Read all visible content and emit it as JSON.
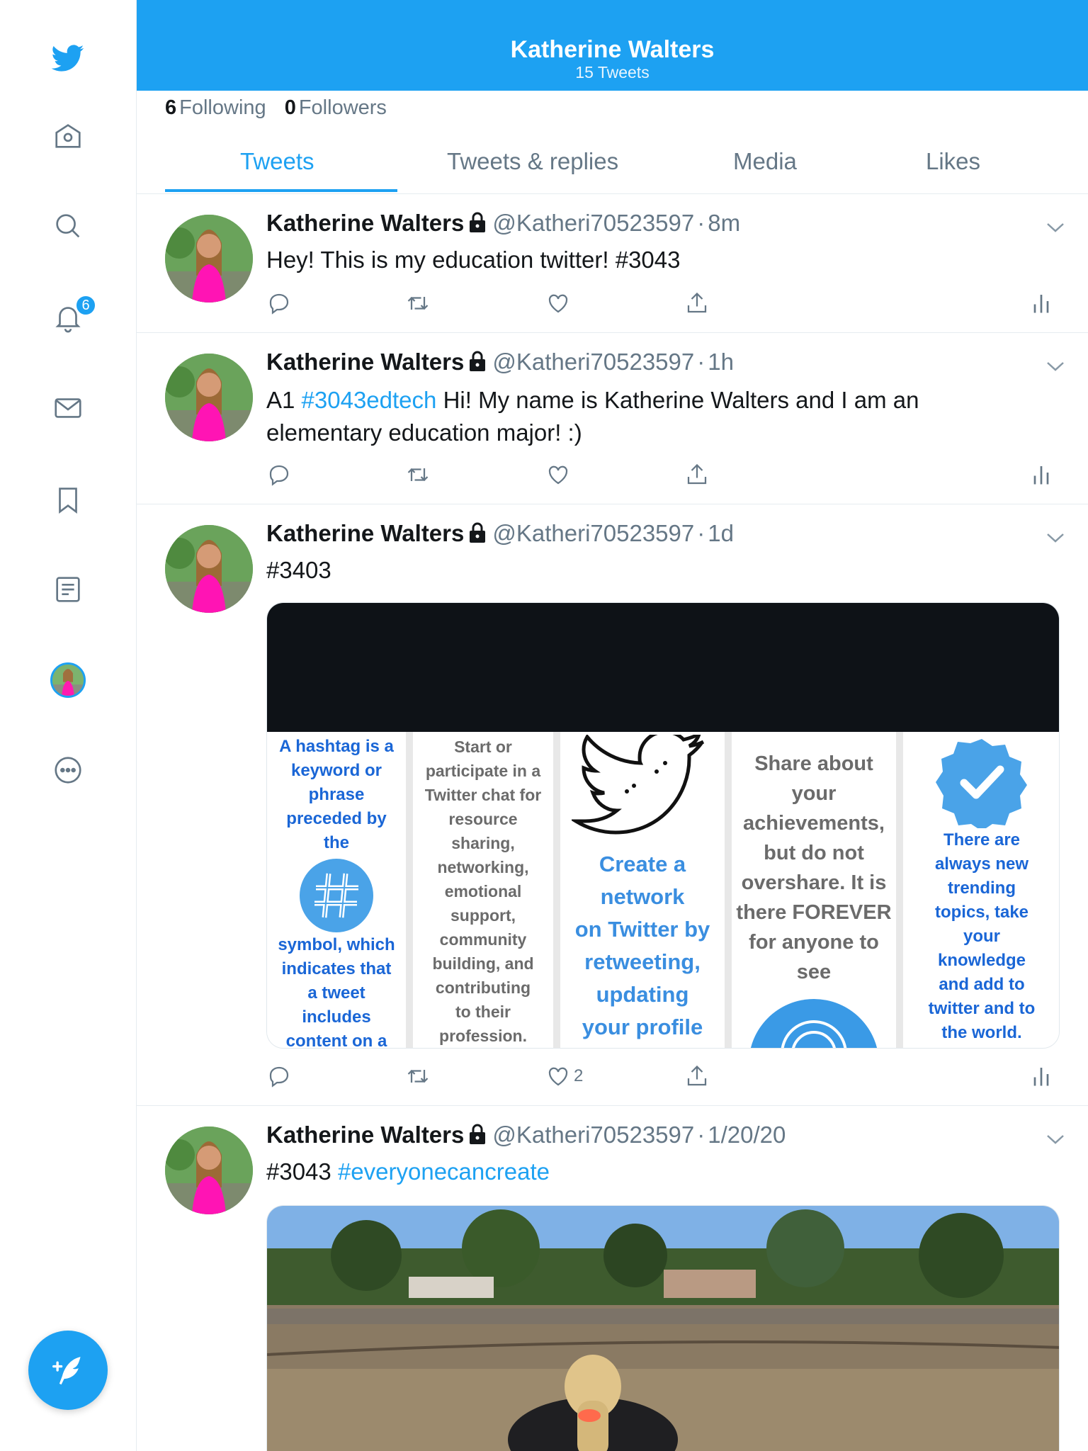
{
  "header": {
    "name": "Katherine Walters",
    "tweet_count": "15 Tweets"
  },
  "stats": {
    "following_count": "6",
    "following_label": "Following",
    "followers_count": "0",
    "followers_label": "Followers"
  },
  "tabs": [
    {
      "label": "Tweets",
      "active": true
    },
    {
      "label": "Tweets & replies",
      "active": false
    },
    {
      "label": "Media",
      "active": false
    },
    {
      "label": "Likes",
      "active": false
    }
  ],
  "sidebar": {
    "items": [
      "twitter-logo",
      "home-icon",
      "search-icon",
      "bell-icon",
      "mail-icon",
      "bookmark-icon",
      "list-icon",
      "profile-avatar",
      "more-icon"
    ],
    "notification_badge": "6"
  },
  "tweets": [
    {
      "name": "Katherine Walters",
      "handle": "@Katheri70523597",
      "sep": "·",
      "time": "8m",
      "text": "Hey! This is my education twitter! #3043"
    },
    {
      "name": "Katherine Walters",
      "handle": "@Katheri70523597",
      "sep": "·",
      "time": "1h",
      "text_prefix": "A1 ",
      "hashtag": "#3043edtech",
      "text_suffix": " Hi! My name is Katherine Walters and I am an elementary education major! :)"
    },
    {
      "name": "Katherine Walters",
      "handle": "@Katheri70523597",
      "sep": "·",
      "time": "1d",
      "text": "#3403",
      "like_count": "2",
      "infographic": {
        "col1_top": [
          "A hashtag is a",
          "keyword or",
          "phrase",
          "preceded by",
          "the"
        ],
        "col1_bottom": [
          "symbol, which",
          "indicates that",
          "a tweet",
          "includes",
          "content on a"
        ],
        "col2": [
          "Start or",
          "participate in a",
          "Twitter chat for",
          "resource",
          "sharing,",
          "networking,",
          "emotional",
          "support,",
          "community",
          "building, and",
          "contributing",
          "to their",
          "profession."
        ],
        "col3": [
          "Create a",
          "network",
          "on Twitter by",
          "retweeting,",
          "updating",
          "your profile"
        ],
        "col4": [
          "Share about",
          "your",
          "achievements,",
          "but do not",
          "overshare. It is",
          "there FOREVER",
          "for anyone to",
          "see"
        ],
        "col5": [
          "There are",
          "always new",
          "trending",
          "topics, take",
          "your",
          "knowledge",
          "and add to",
          "twitter and to",
          "the world."
        ]
      }
    },
    {
      "name": "Katherine Walters",
      "handle": "@Katheri70523597",
      "sep": "·",
      "time": "1/20/20",
      "text_prefix": "#3043 ",
      "hashtag": "#everyonecancreate"
    }
  ],
  "colors": {
    "accent": "#1da1f2",
    "secondary_text": "#657786",
    "primary_text": "#14171a",
    "divider": "#e6ecf0"
  }
}
